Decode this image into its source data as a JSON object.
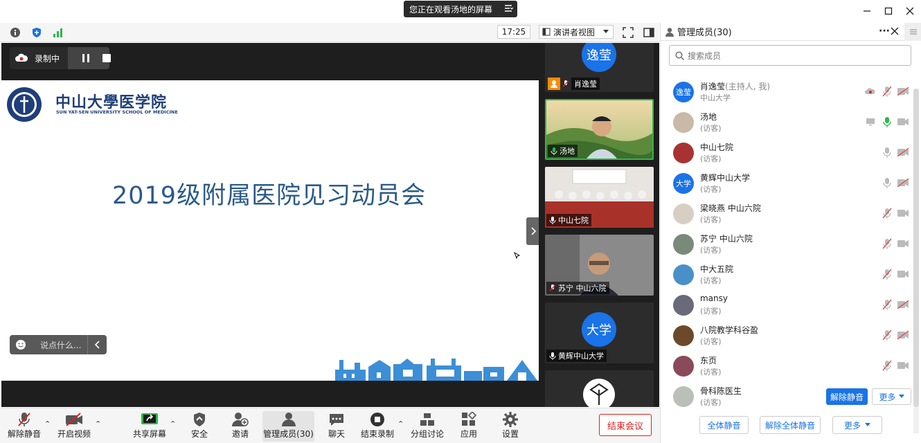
{
  "banner": {
    "text": "您正在观看汤地的屏幕"
  },
  "toolbar": {
    "time": "17:25",
    "view_label": "演讲者视图"
  },
  "recording": {
    "label": "录制中"
  },
  "slide": {
    "org_cn": "中山大學医学院",
    "org_en": "SUN YAT-SEN UNIVERSITY SCHOOL OF MEDICINE",
    "title": "2019级附属医院见习动员会"
  },
  "chat_input": {
    "placeholder": "说点什么..."
  },
  "video_tiles": [
    {
      "name": "肖逸莹",
      "avatar": "逸莹"
    },
    {
      "name": "汤地"
    },
    {
      "name": "中山七院"
    },
    {
      "name": "苏宁 中山六院"
    },
    {
      "name": "黄辉中山大学",
      "avatar": "大学"
    }
  ],
  "panel": {
    "title": "管理成员(30)",
    "search_placeholder": "搜索成员",
    "participants": [
      {
        "name": "肖逸莹",
        "hint": "(主持人, 我)",
        "sub": "中山大学",
        "avatar_text": "逸莹",
        "avatar_color": "#1a73e8"
      },
      {
        "name": "汤地",
        "hint": "",
        "sub": "(访客)",
        "avatar_text": "",
        "avatar_color": "#c9b9a6"
      },
      {
        "name": "中山七院",
        "hint": "",
        "sub": "(访客)",
        "avatar_text": "",
        "avatar_color": "#a83232"
      },
      {
        "name": "黄辉中山大学",
        "hint": "",
        "sub": "(访客)",
        "avatar_text": "大学",
        "avatar_color": "#1a73e8"
      },
      {
        "name": "梁晓燕 中山六院",
        "hint": "",
        "sub": "(访客)",
        "avatar_text": "",
        "avatar_color": "#d8cfc4"
      },
      {
        "name": "苏宁 中山六院",
        "hint": "",
        "sub": "(访客)",
        "avatar_text": "",
        "avatar_color": "#7a8a7a"
      },
      {
        "name": "中大五院",
        "hint": "",
        "sub": "(访客)",
        "avatar_text": "",
        "avatar_color": "#4a90c8"
      },
      {
        "name": "mansy",
        "hint": "",
        "sub": "(访客)",
        "avatar_text": "",
        "avatar_color": "#6a6a7a"
      },
      {
        "name": "八院教学科谷盈",
        "hint": "",
        "sub": "(访客)",
        "avatar_text": "",
        "avatar_color": "#6b4a2a"
      },
      {
        "name": "东页",
        "hint": "",
        "sub": "(访客)",
        "avatar_text": "",
        "avatar_color": "#8a4a5a"
      },
      {
        "name": "骨科陈医生",
        "hint": "",
        "sub": "(访客)",
        "avatar_text": "",
        "avatar_color": "#b8c0b8"
      }
    ],
    "unmute_label": "解除静音",
    "more_label": "更多",
    "mute_all": "全体静音",
    "unmute_all": "解除全体静音",
    "more_bottom": "更多"
  },
  "bottom": {
    "unmute": "解除静音",
    "start_video": "开启视频",
    "share": "共享屏幕",
    "security": "安全",
    "invite": "邀请",
    "members": "管理成员(30)",
    "chat": "聊天",
    "end_record": "结束录制",
    "breakout": "分组讨论",
    "apps": "应用",
    "settings": "设置",
    "end_meeting": "结束会议"
  },
  "colors": {
    "accent": "#1a73e8",
    "danger": "#e02020",
    "slide_title": "#2a5a8a",
    "dark_bg": "#1e1e1e"
  }
}
